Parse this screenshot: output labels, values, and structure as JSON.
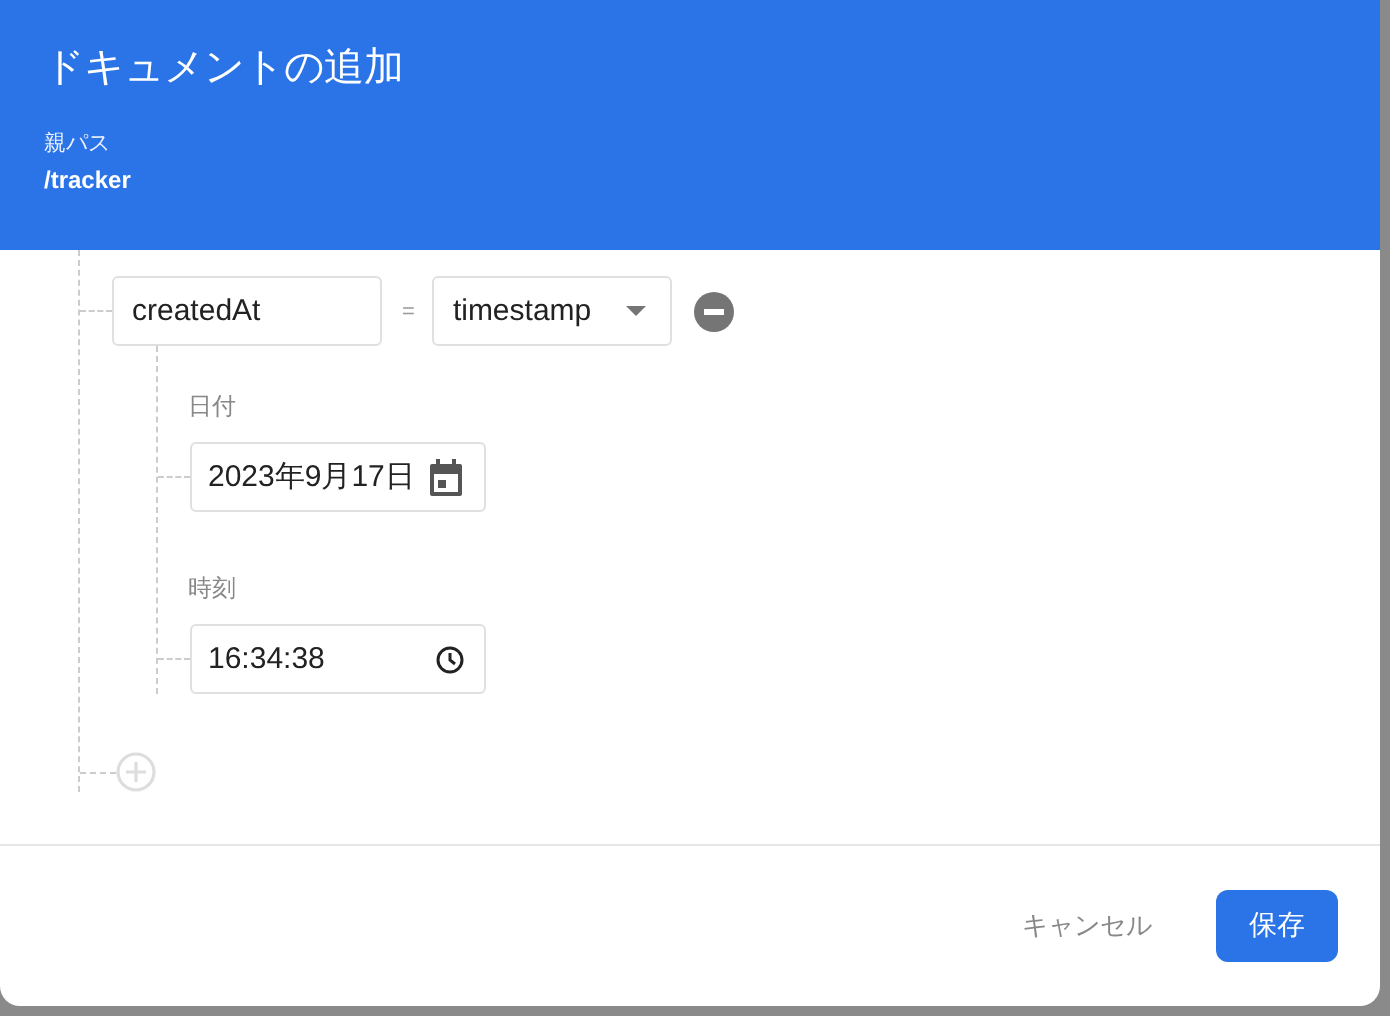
{
  "dialog": {
    "title": "ドキュメントの追加",
    "parent_path": {
      "label": "親パス",
      "value": "/tracker"
    }
  },
  "field": {
    "name": "createdAt",
    "operator": "=",
    "type": "timestamp",
    "subfields": [
      {
        "kind": "date",
        "label": "日付",
        "value": "2023年9月17日"
      },
      {
        "kind": "time",
        "label": "時刻",
        "value": "16:34:38"
      }
    ]
  },
  "buttons": [
    {
      "kind": "text",
      "label": "キャンセル"
    },
    {
      "kind": "primary",
      "label": "保存"
    }
  ]
}
